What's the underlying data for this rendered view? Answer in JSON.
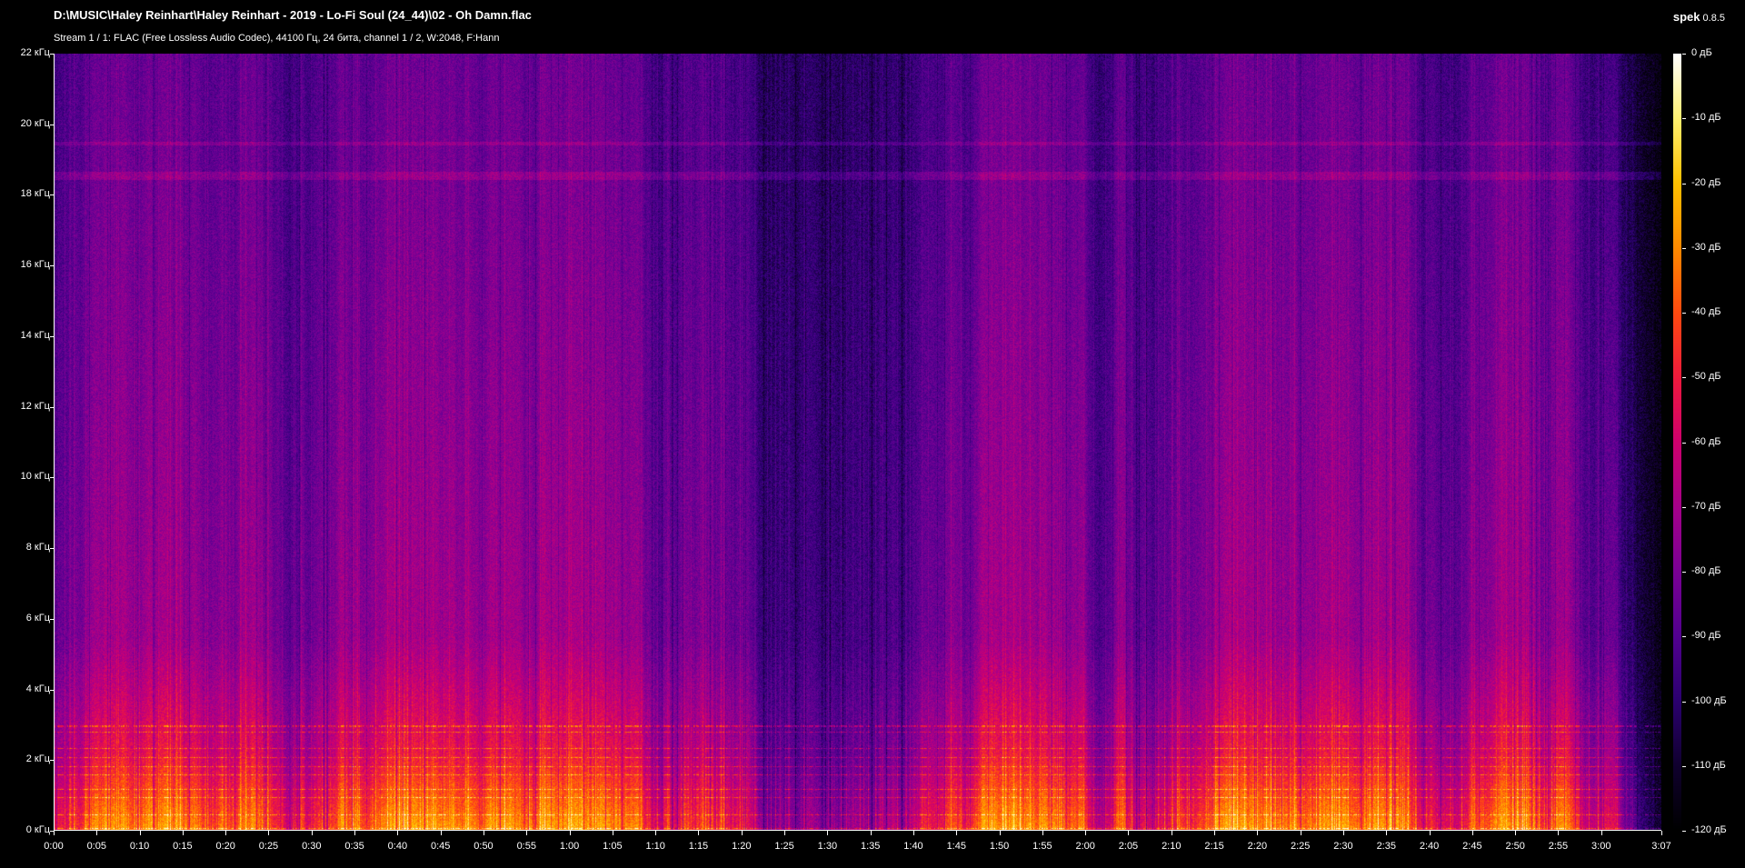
{
  "header": {
    "file_path": "D:\\MUSIC\\Haley Reinhart\\Haley Reinhart - 2019 - Lo-Fi Soul (24_44)\\02 - Oh Damn.flac",
    "stream_info": "Stream 1 / 1: FLAC (Free Lossless Audio Codec), 44100 Гц, 24 бита, channel 1 / 2, W:2048, F:Hann",
    "app_name": "spek",
    "app_version": "0.8.5"
  },
  "axes": {
    "frequency_labels": [
      "22 кГц",
      "20 кГц",
      "18 кГц",
      "16 кГц",
      "14 кГц",
      "12 кГц",
      "10 кГц",
      "8 кГц",
      "6 кГц",
      "4 кГц",
      "2 кГц",
      "0 кГц"
    ],
    "frequency_values_khz": [
      22,
      20,
      18,
      16,
      14,
      12,
      10,
      8,
      6,
      4,
      2,
      0
    ],
    "time_labels": [
      "0:00",
      "0:05",
      "0:10",
      "0:15",
      "0:20",
      "0:25",
      "0:30",
      "0:35",
      "0:40",
      "0:45",
      "0:50",
      "0:55",
      "1:00",
      "1:05",
      "1:10",
      "1:15",
      "1:20",
      "1:25",
      "1:30",
      "1:35",
      "1:40",
      "1:45",
      "1:50",
      "1:55",
      "2:00",
      "2:05",
      "2:10",
      "2:15",
      "2:20",
      "2:25",
      "2:30",
      "2:35",
      "2:40",
      "2:45",
      "2:50",
      "2:55",
      "3:00",
      "3:07"
    ],
    "time_values_sec": [
      0,
      5,
      10,
      15,
      20,
      25,
      30,
      35,
      40,
      45,
      50,
      55,
      60,
      65,
      70,
      75,
      80,
      85,
      90,
      95,
      100,
      105,
      110,
      115,
      120,
      125,
      130,
      135,
      140,
      145,
      150,
      155,
      160,
      165,
      170,
      175,
      180,
      187
    ],
    "duration_sec": 187,
    "max_frequency_khz": 22
  },
  "colorbar": {
    "db_labels": [
      "0 дБ",
      "-10 дБ",
      "-20 дБ",
      "-30 дБ",
      "-40 дБ",
      "-50 дБ",
      "-60 дБ",
      "-70 дБ",
      "-80 дБ",
      "-90 дБ",
      "-100 дБ",
      "-110 дБ",
      "-120 дБ"
    ],
    "db_values": [
      0,
      -10,
      -20,
      -30,
      -40,
      -50,
      -60,
      -70,
      -80,
      -90,
      -100,
      -110,
      -120
    ],
    "palette": [
      "#000000",
      "#10002e",
      "#2b0070",
      "#52008f",
      "#7a0094",
      "#a5008a",
      "#cf006e",
      "#ee1a3d",
      "#ff4a10",
      "#ff8a00",
      "#ffc000",
      "#fff070",
      "#ffffff"
    ]
  },
  "colors": {
    "background": "#000000",
    "text": "#ffffff"
  }
}
